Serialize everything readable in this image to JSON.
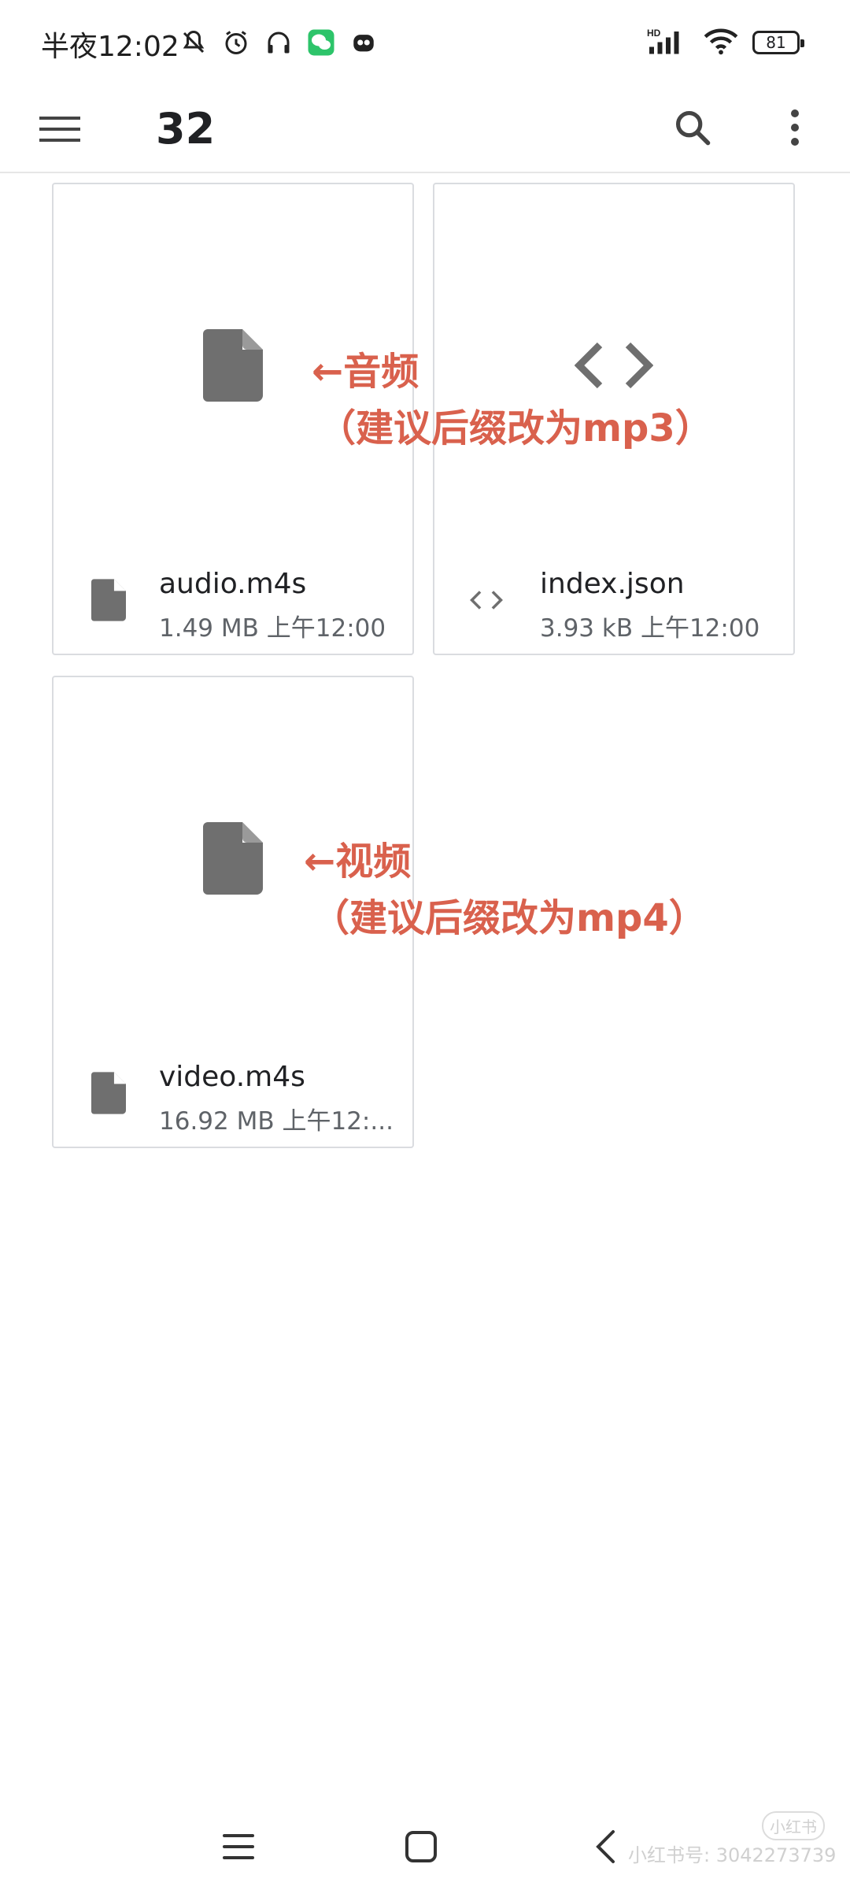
{
  "status_bar": {
    "time": "半夜12:02",
    "battery": "81",
    "network": "HD"
  },
  "app_bar": {
    "title": "32"
  },
  "files": [
    {
      "name": "audio.m4s",
      "meta": "1.49 MB 上午12:00",
      "type": "file"
    },
    {
      "name": "index.json",
      "meta": "3.93 kB 上午12:00",
      "type": "code"
    },
    {
      "name": "video.m4s",
      "meta": "16.92 MB 上午12:...",
      "type": "file"
    }
  ],
  "annotations": {
    "audio_line1": "←音频",
    "audio_line2": "（建议后缀改为mp3）",
    "video_line1": "←视频",
    "video_line2": "（建议后缀改为mp4）"
  },
  "watermark": {
    "text": "小红书号: 3042273739",
    "logo": "小红书"
  },
  "colors": {
    "annotation": "#d9614d",
    "icon_gray": "#6f6f6f"
  }
}
